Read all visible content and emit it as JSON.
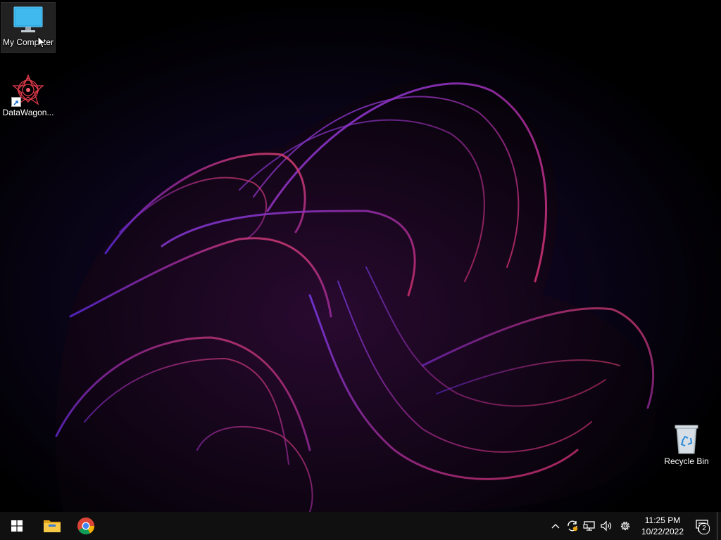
{
  "desktop": {
    "icons": [
      {
        "label": "My Computer",
        "icon": "monitor-icon"
      },
      {
        "label": "DataWagon...",
        "icon": "datawagon-icon"
      },
      {
        "label": "Recycle Bin",
        "icon": "recycle-bin-icon"
      }
    ]
  },
  "taskbar": {
    "start": {
      "icon": "windows-start-icon"
    },
    "pinned": [
      {
        "icon": "file-explorer-icon"
      },
      {
        "icon": "chrome-icon"
      }
    ],
    "tray": {
      "icons": [
        "chevron-up-icon",
        "sync-icon",
        "network-icon",
        "volume-icon",
        "settings-gear-icon"
      ],
      "time": "11:25 PM",
      "date": "10/22/2022",
      "notifications_count": "2"
    }
  },
  "colors": {
    "taskbar_bg": "#101010",
    "wallpaper_accent": "#c0306e",
    "wallpaper_violet": "#6a2ce0"
  }
}
